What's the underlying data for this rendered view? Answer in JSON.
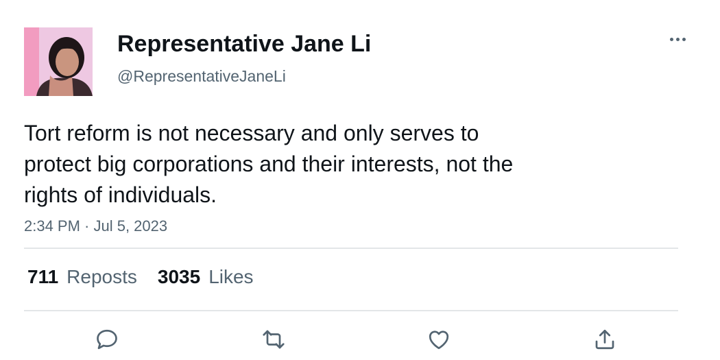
{
  "author": {
    "display_name": "Representative Jane Li",
    "handle": "@RepresentativeJaneLi"
  },
  "tweet": {
    "lines": [
      "Tort reform is not necessary and only serves to",
      "protect big corporations and their interests, not the",
      "rights of individuals."
    ],
    "timestamp": "2:34 PM · Jul 5, 2023"
  },
  "stats": {
    "reposts_count": "711",
    "reposts_label": "Reposts",
    "likes_count": "3035",
    "likes_label": "Likes"
  },
  "colors": {
    "secondary_text": "#536471",
    "primary_text": "#0f1419",
    "divider": "#e3e6e8"
  },
  "icons": {
    "more": "more-horizontal-icon",
    "reply": "reply-icon",
    "repost": "repost-icon",
    "like": "heart-icon",
    "share": "share-icon"
  }
}
